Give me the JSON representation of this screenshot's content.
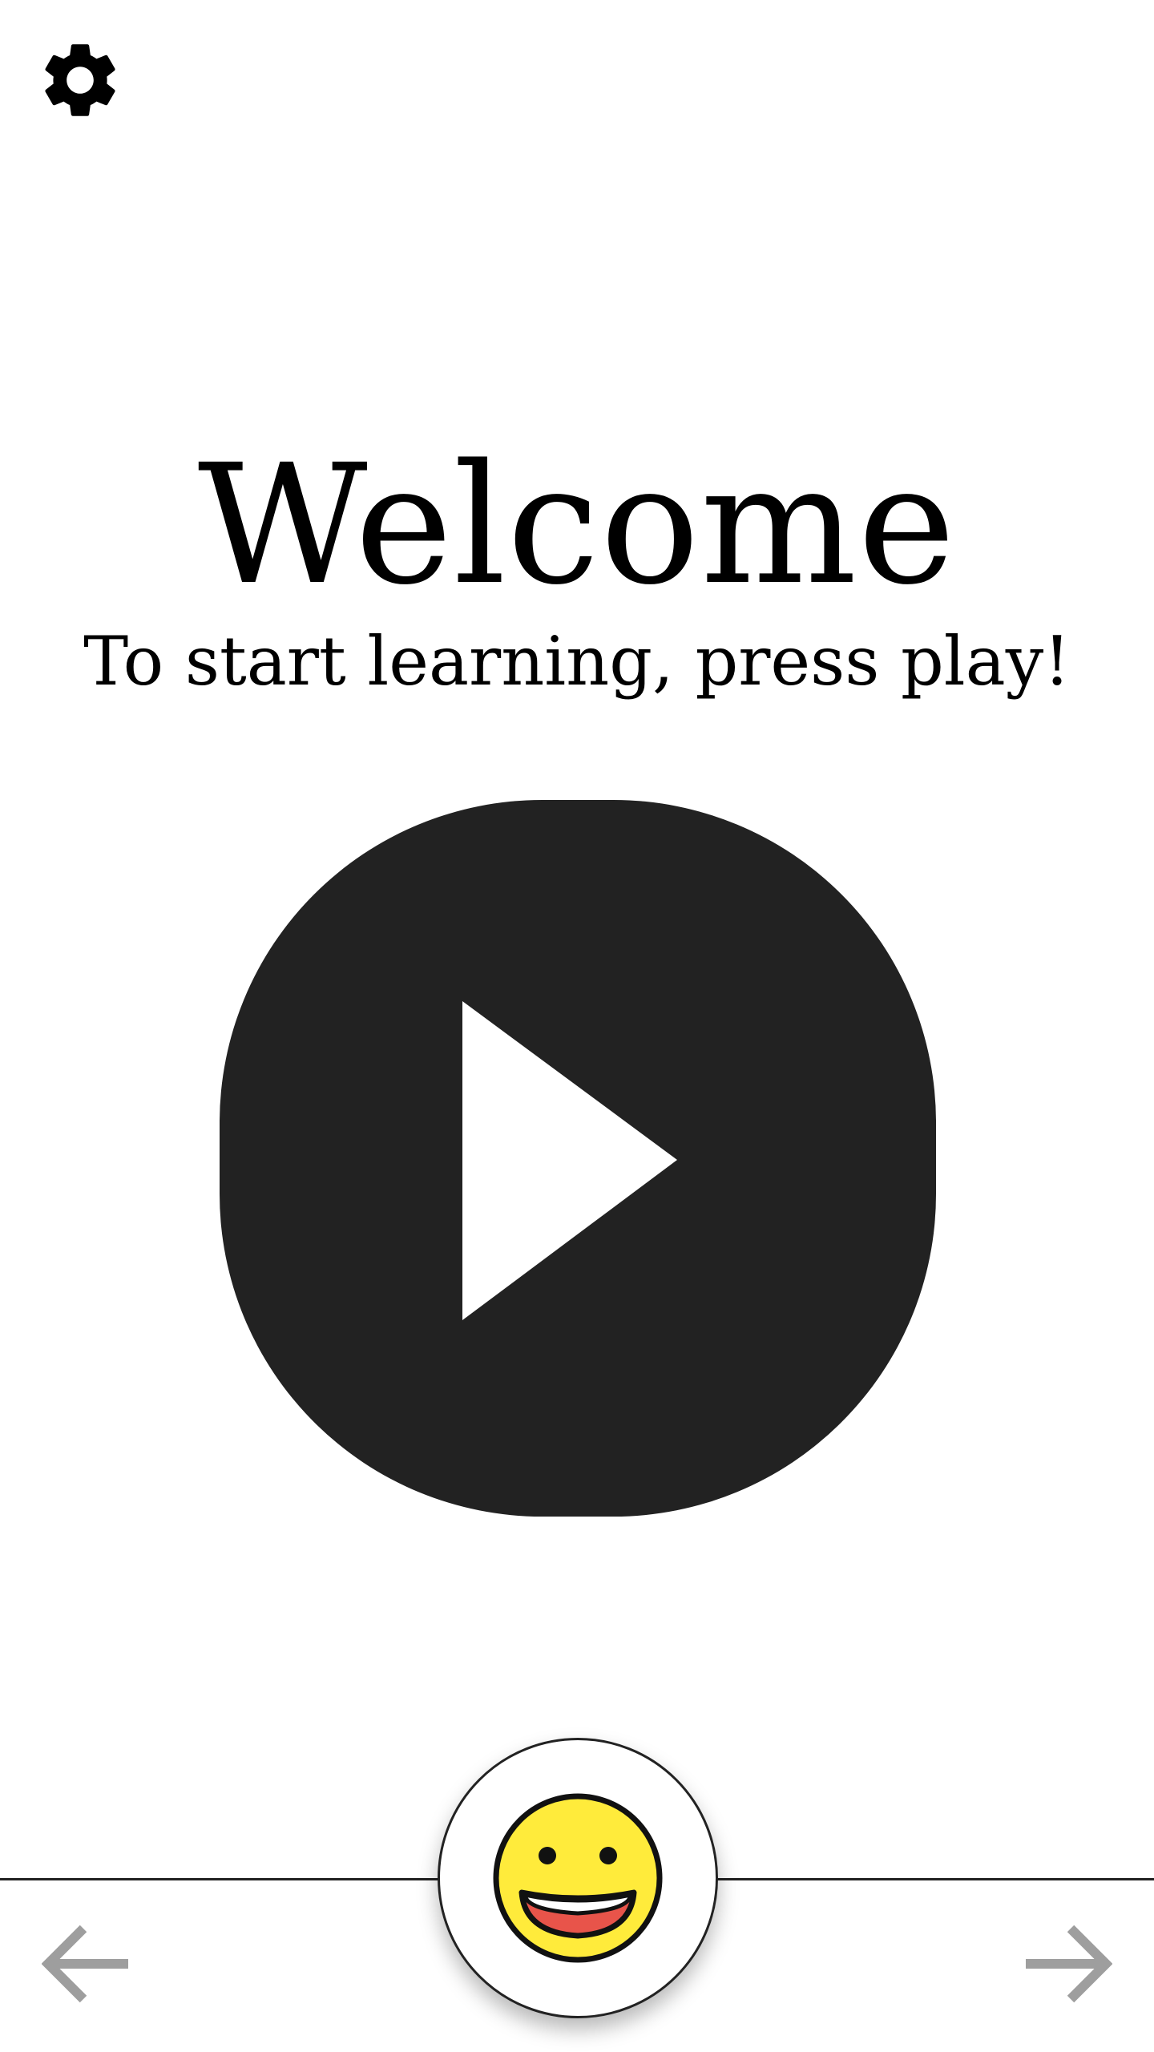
{
  "header": {
    "settings_icon": "gear-icon"
  },
  "welcome": {
    "title": "Welcome",
    "subtitle": "To start learning, press play!"
  },
  "play": {
    "icon": "play-icon",
    "button_color": "#222222",
    "icon_color": "#ffffff"
  },
  "mascot": {
    "icon": "smiley-face-icon",
    "face_color": "#FFEB3B",
    "mouth_color": "#E8544A"
  },
  "navigation": {
    "prev_icon": "arrow-left-icon",
    "next_icon": "arrow-right-icon",
    "arrow_color": "#9E9E9E"
  }
}
